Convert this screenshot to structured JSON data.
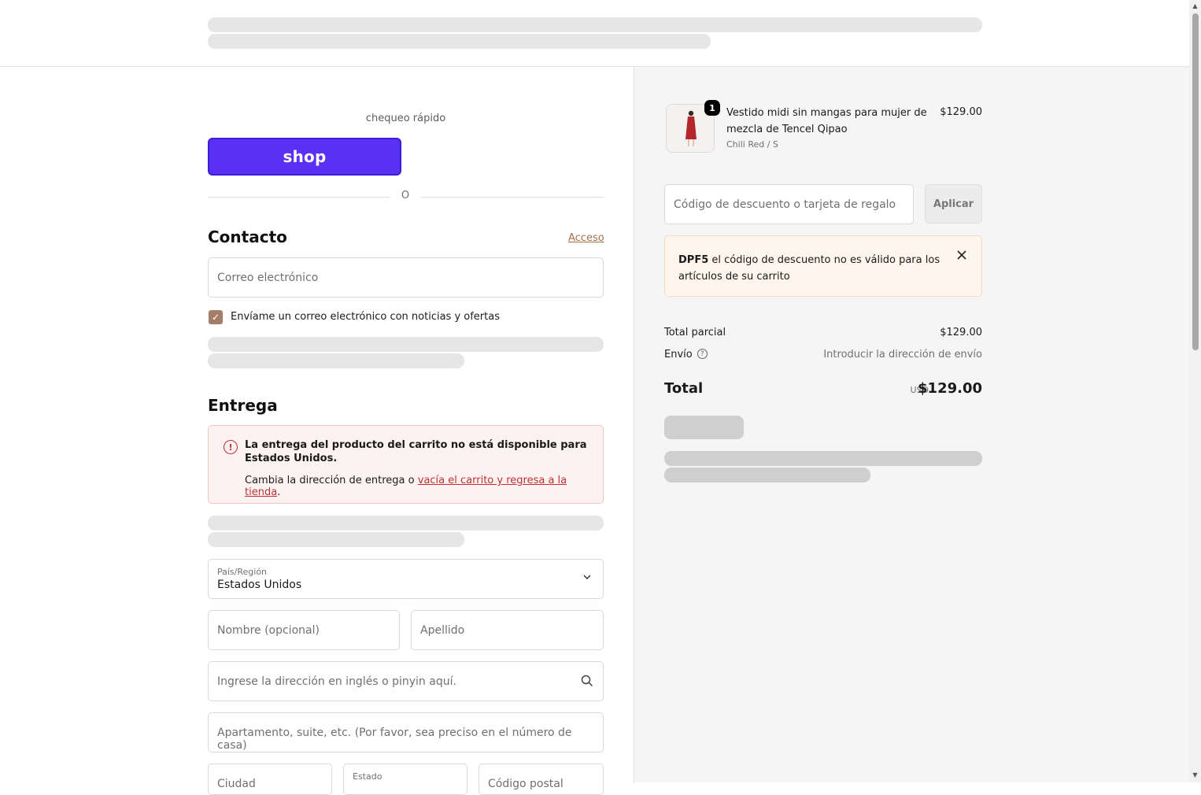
{
  "checkout": {
    "express_label": "chequeo rápido",
    "shop_button_label": "shop",
    "divider_text": "O",
    "contact": {
      "heading": "Contacto",
      "login_link": "Acceso",
      "email_placeholder": "Correo electrónico",
      "newsletter_checked": true,
      "newsletter_label": "Envíame un correo electrónico con noticias y ofertas"
    },
    "delivery": {
      "heading": "Entrega",
      "alert_title": "La entrega del producto del carrito no está disponible para Estados Unidos.",
      "alert_body_prefix": "Cambia la dirección de entrega o ",
      "alert_link": "vacía el carrito y regresa a la tienda",
      "alert_body_suffix": ".",
      "country_label": "País/Región",
      "country_value": "Estados Unidos",
      "first_name_placeholder": "Nombre (opcional)",
      "last_name_placeholder": "Apellido",
      "address_placeholder": "Ingrese la dirección en inglés o pinyin aquí.",
      "apartment_placeholder": "Apartamento, suite, etc. (Por favor, sea preciso en el número de casa)",
      "city_placeholder": "Ciudad",
      "state_label": "Estado",
      "postal_placeholder": "Código postal"
    }
  },
  "summary": {
    "item": {
      "quantity": "1",
      "name": "Vestido midi sin mangas para mujer de mezcla de Tencel Qipao",
      "variant": "Chili Red / S",
      "price": "$129.00"
    },
    "discount_placeholder": "Código de descuento o tarjeta de regalo",
    "apply_label": "Aplicar",
    "warning_code": "DPF5",
    "warning_text": " el código de descuento no es válido para los artículos de su carrito",
    "subtotal_label": "Total parcial",
    "subtotal_value": "$129.00",
    "shipping_label": "Envío",
    "shipping_value": "Introducir la dirección de envío",
    "total_label": "Total",
    "total_currency": "USD",
    "total_value": "$129.00"
  },
  "colors": {
    "shop_purple": "#5a31f4",
    "error_red": "#c03030",
    "checkbox_brown": "#a57e6a",
    "warning_bg": "#fef6ec"
  },
  "icons": [
    "check-icon",
    "error-icon",
    "chevron-down-icon",
    "search-icon",
    "close-icon",
    "help-icon"
  ]
}
